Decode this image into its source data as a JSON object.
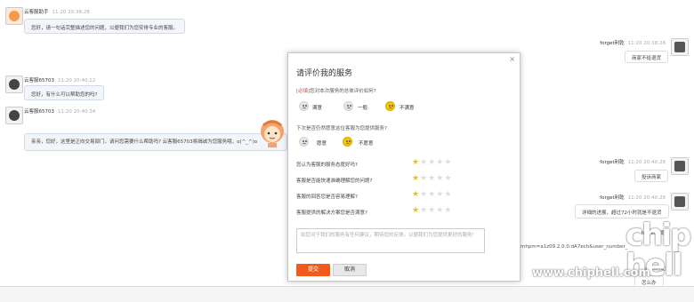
{
  "chat": {
    "messages_left": [
      {
        "sender": "云客服助手",
        "time": "11:20 20:38:28",
        "text": "您好，请一句话完整描述您的问题，以便我们为您安排专业的客服。"
      },
      {
        "sender": "云客服65703",
        "time": "11:20 20:40:12",
        "text": "您好，有什么可以帮助您的吗?"
      },
      {
        "sender": "云客服65703",
        "time": "11:20 20:40:34",
        "text": "亲亲，您好，这里是正向交易部门，请问您需要什么帮助吗? 云客服65703将竭诚为您服务哦，o(^_^)o"
      }
    ],
    "messages_right": [
      {
        "sender": "forget利乾",
        "time": "11:20 20:38:28",
        "text": "商家不给退货"
      },
      {
        "sender": "forget利乾",
        "time": "11:20 20:40:28",
        "text": "投诉商家"
      },
      {
        "sender": "forget利乾",
        "time": "11:20 20:40:28",
        "text": "详细的进展，超过72小时就是不退货"
      },
      {
        "sender": "forget利乾",
        "time": "",
        "text": "--"
      },
      {
        "sender": "forget利乾",
        "time": "",
        "text": "怎么办"
      }
    ],
    "link_fragment": "cmhpm=a1z09.2.0.0.dA7ech&user_number_"
  },
  "dialog": {
    "title": "请评价我的服务",
    "close": "×",
    "q1_tag": "[必填]",
    "q1": "您对本次服务的总体评价如何?",
    "q1_options": [
      "满意",
      "一般",
      "不满意"
    ],
    "q1_selected": 2,
    "q2": "下次是否仍然愿意这位客服为您提供服务?",
    "q2_options": [
      "愿意",
      "不愿意"
    ],
    "q2_selected": 1,
    "rating_questions": [
      {
        "label": "您认为客服的服务态度好吗?",
        "stars": 1
      },
      {
        "label": "客服是否能快速准确理解您的问题?",
        "stars": 1
      },
      {
        "label": "客服的回答您是否容易理解?",
        "stars": 1
      },
      {
        "label": "客服提供的解决方案您是否满意?",
        "stars": 1
      }
    ],
    "star_total": 5,
    "feedback_placeholder": "如您对于我们的服务有任何建议，期待您的反馈，以便我们为您提供更好的服务!",
    "submit_label": "提交",
    "cancel_label": "取消"
  },
  "watermark": {
    "brand": "chip hell",
    "url": "www.chiphell.com"
  },
  "colors": {
    "accent": "#f05a1a",
    "required": "#e4393c",
    "star_on": "#f3c100",
    "star_off": "#dddddd",
    "smiley_selected": "#f4c60c"
  }
}
